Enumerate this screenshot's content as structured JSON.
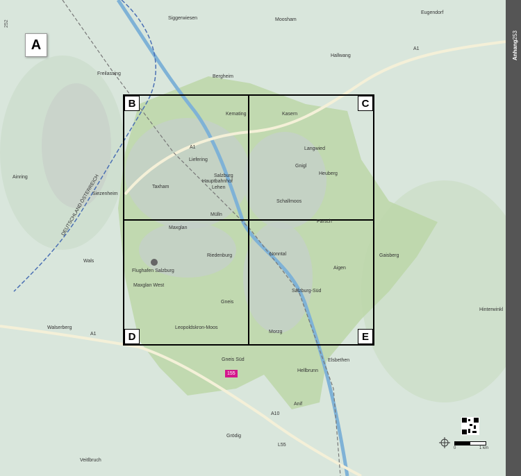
{
  "map_letter": "A",
  "sidebar": {
    "section": "Anhang",
    "page": "253"
  },
  "edge_page_ref": "252",
  "grid": [
    "B",
    "C",
    "D",
    "E"
  ],
  "pin_label": "155",
  "scale": {
    "start": "0",
    "end": "1 km"
  },
  "places": [
    "Siggerwiesen",
    "Moosham",
    "Eugendorf",
    "Freilassing",
    "Hallwang",
    "Bergheim",
    "Kemating",
    "Kasern",
    "Liefering",
    "Langwied",
    "Gnigl",
    "Heuberg",
    "Salzburg Hauptbahnhof",
    "Lehen",
    "Taxham",
    "Ainring",
    "Siezenheim",
    "Schallmoos",
    "Mülln",
    "Parsch",
    "Maxglan",
    "Riedenburg",
    "Nonntal",
    "Gaisberg",
    "Wals",
    "Flughafen Salzburg",
    "Aigen",
    "Maxglan West",
    "Salzburg-Süd",
    "Gneis",
    "Hinterwinkl",
    "Walserberg",
    "Leopoldskron-Moos",
    "Morzg",
    "Elsbethen",
    "Gneis Süd",
    "Hellbrunn",
    "Anif",
    "Grödig",
    "Veitlbruch"
  ],
  "road_labels": [
    "A1",
    "A1",
    "A1",
    "A10",
    "L55"
  ],
  "border_label": "DEUTSCHLAND ÖSTERREICH",
  "colors": {
    "background": "#d9e6dc",
    "city_zone": "#b9d4a4",
    "river": "#7fb2d6",
    "pin": "#d3188c",
    "sidebar": "#555555"
  }
}
